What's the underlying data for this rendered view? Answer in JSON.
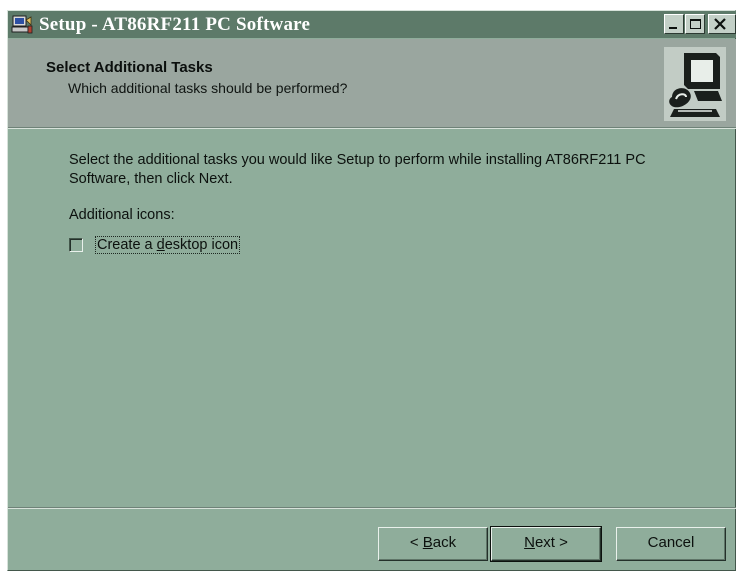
{
  "window": {
    "title": "Setup - AT86RF211 PC Software",
    "app_icon": "setup-computer-icon"
  },
  "titlebar_buttons": [
    "minimize-icon",
    "maximize-icon",
    "close-icon"
  ],
  "header": {
    "title": "Select Additional Tasks",
    "subtitle": "Which additional tasks should be performed?",
    "art_icon": "installer-computer-icon"
  },
  "content": {
    "instructions": "Select the additional tasks you would like Setup to perform while installing AT86RF211 PC Software, then click Next.",
    "group_label": "Additional icons:",
    "tasks": [
      {
        "prefix": "Create a ",
        "mnemonic": "d",
        "suffix": "esktop icon",
        "checked": false
      }
    ]
  },
  "buttons": {
    "back": {
      "prefix": "< ",
      "mnemonic": "B",
      "suffix": "ack"
    },
    "next": {
      "prefix": "",
      "mnemonic": "N",
      "suffix": "ext >"
    },
    "cancel": "Cancel"
  },
  "colors": {
    "titlebar": "#5d7a69",
    "window_face": "#8fad9b",
    "header_bg": "#9aa69f"
  }
}
